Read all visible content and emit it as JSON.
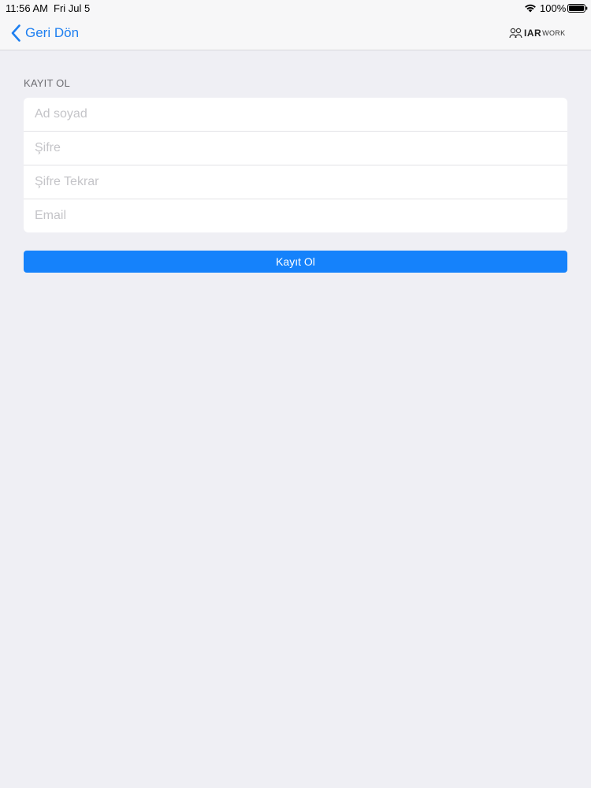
{
  "status_bar": {
    "time": "11:56 AM",
    "date": "Fri Jul 5",
    "battery_percent": "100%"
  },
  "nav": {
    "back_label": "Geri Dön",
    "logo_bold": "IAR",
    "logo_light": "WORK"
  },
  "form": {
    "section_title": "KAYIT OL",
    "fields": [
      {
        "placeholder": "Ad soyad",
        "value": ""
      },
      {
        "placeholder": "Şifre",
        "value": ""
      },
      {
        "placeholder": "Şifre Tekrar",
        "value": ""
      },
      {
        "placeholder": "Email",
        "value": ""
      }
    ],
    "submit_label": "Kayıt Ol"
  },
  "colors": {
    "accent": "#1582fb",
    "nav_tint": "#1e7ff0",
    "background": "#efeff4"
  },
  "icons": [
    "wifi-icon",
    "battery-icon",
    "chevron-left-icon",
    "people-logo-icon"
  ]
}
